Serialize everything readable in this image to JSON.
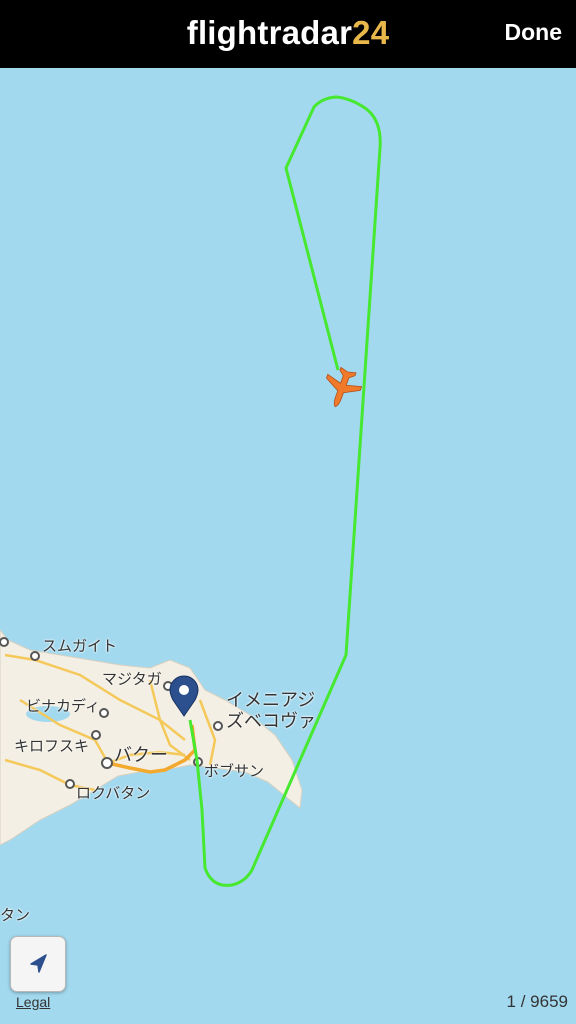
{
  "header": {
    "logo_text": "flightradar",
    "logo_number": "24",
    "done_label": "Done"
  },
  "map": {
    "labels": [
      "スムガイト",
      "マジタガ",
      "ビナカディ",
      "キロフスキ",
      "バクー",
      "ロクバタン",
      "イメニアジ",
      "ズベコヴァ",
      "ボブサン",
      "タン"
    ],
    "track_color": "#46e830",
    "aircraft_color": "#f07a2a",
    "pin_color": "#2c4f8e"
  },
  "footer": {
    "legal_label": "Legal",
    "counter": "1 / 9659"
  },
  "icons": {
    "locate": "location-arrow-icon",
    "aircraft": "airplane-icon",
    "pin": "map-pin-icon"
  }
}
